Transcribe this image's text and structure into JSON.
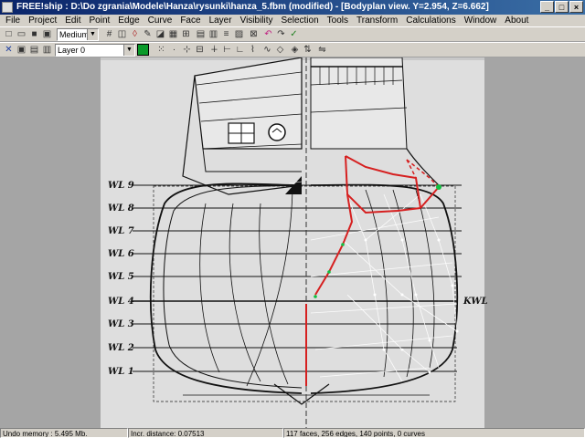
{
  "window": {
    "title": "FREE!ship   : D:\\Do zgrania\\Modele\\Hanza\\rysunki\\hanza_5.fbm (modified) - [Bodyplan view.  Y=2.954,  Z=6.662]"
  },
  "menu": [
    "File",
    "Project",
    "Edit",
    "Point",
    "Edge",
    "Curve",
    "Face",
    "Layer",
    "Visibility",
    "Selection",
    "Tools",
    "Transform",
    "Calculations",
    "Window",
    "About"
  ],
  "toolbar": {
    "precision": "Medium",
    "layer": "Layer 0"
  },
  "drawing": {
    "waterlines": [
      "WL 9",
      "WL 8",
      "WL 7",
      "WL 6",
      "WL 5",
      "WL 4",
      "WL 3",
      "WL 2",
      "WL 1"
    ],
    "kwl_label": "KWL"
  },
  "status": {
    "undo": "Undo memory : 5.495 Mb.",
    "incr": "Incr. distance: 0.07513",
    "counts": "117 faces, 256 edges, 140 points, 0 curves"
  }
}
